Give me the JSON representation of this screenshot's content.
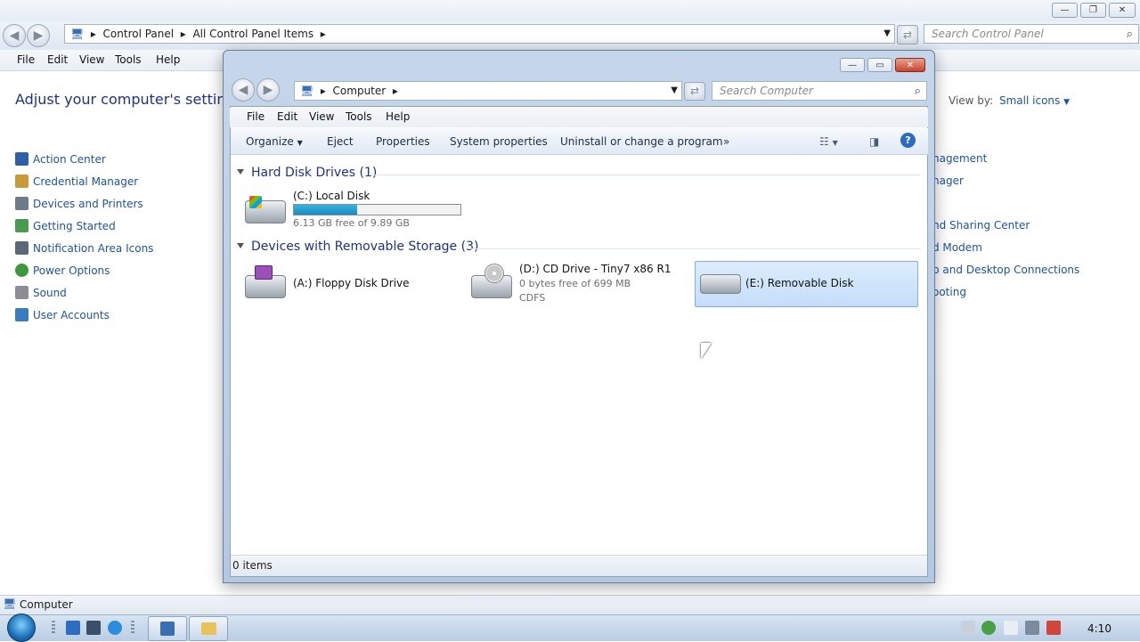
{
  "control_panel": {
    "address": {
      "seg1": "Control Panel",
      "seg2": "All Control Panel Items"
    },
    "search_placeholder": "Search Control Panel",
    "menu": [
      "File",
      "Edit",
      "View",
      "Tools",
      "Help"
    ],
    "heading": "Adjust your computer's settings",
    "view_by_label": "View by:",
    "view_by_value": "Small icons",
    "left_items": [
      "Action Center",
      "Credential Manager",
      "Devices and Printers",
      "Getting Started",
      "Notification Area Icons",
      "Power Options",
      "Sound",
      "User Accounts"
    ],
    "right_items": [
      "nagement",
      "nager",
      "nd Sharing Center",
      "d Modem",
      "p and Desktop Connections",
      "ooting"
    ],
    "status_text": "Computer"
  },
  "computer_window": {
    "address": "Computer",
    "search_placeholder": "Search Computer",
    "menu": [
      "File",
      "Edit",
      "View",
      "Tools",
      "Help"
    ],
    "commands": {
      "organize": "Organize",
      "eject": "Eject",
      "properties": "Properties",
      "system_properties": "System properties",
      "uninstall": "Uninstall or change a program",
      "more": "»"
    },
    "groups": {
      "hdd": "Hard Disk Drives (1)",
      "removable": "Devices with Removable Storage (3)"
    },
    "drives": {
      "c": {
        "name": "(C:) Local Disk",
        "free": "6.13 GB free of 9.89 GB",
        "used_fraction": 0.38
      },
      "a": {
        "name": "(A:) Floppy Disk Drive"
      },
      "d": {
        "name": "(D:) CD Drive - Tiny7 x86 R1",
        "free": "0 bytes free of 699 MB",
        "fs": "CDFS"
      },
      "e": {
        "name": "(E:) Removable Disk"
      }
    },
    "status": "0 items"
  },
  "taskbar": {
    "clock": "4:10"
  },
  "colors": {
    "link": "#1e53a5",
    "heading": "#1e3287",
    "selection": "#c4defa",
    "progress": "#1a8bbf"
  }
}
